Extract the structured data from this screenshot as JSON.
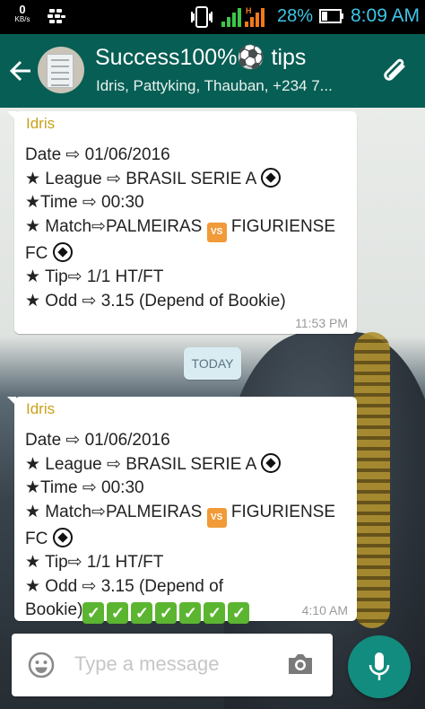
{
  "status_bar": {
    "speed_value": "0",
    "speed_unit": "KB/s",
    "network_label": "H",
    "battery_percent": "28%",
    "time": "8:09 AM"
  },
  "header": {
    "title": "Success100%⚽ tips",
    "subtitle": "Idris, Pattyking, Thauban, +234 7..."
  },
  "messages": [
    {
      "sender": "Idris",
      "lines": [
        "Date ⇨ 01/06/2016",
        "★ League ⇨ BRASIL SERIE A",
        "★Time ⇨ 00:30",
        "★ Match⇨PALMEIRAS",
        "FIGURIENSE",
        "FC",
        "★ Tip⇨ 1/1 HT/FT",
        "★ Odd ⇨ 3.15 (Depend of Bookie)"
      ],
      "time": "11:53 PM"
    },
    {
      "sender": "Idris",
      "lines": [
        "Date ⇨ 01/06/2016",
        "★ League ⇨ BRASIL SERIE A",
        "★Time ⇨ 00:30",
        "★ Match⇨PALMEIRAS",
        "FIGURIENSE",
        "FC",
        "★ Tip⇨ 1/1 HT/FT",
        "★ Odd ⇨ 3.15 (Depend of",
        "Bookie)"
      ],
      "time": "4:10 AM",
      "checkmark_count": 7
    }
  ],
  "date_divider": "TODAY",
  "composer": {
    "placeholder": "Type a message"
  },
  "colors": {
    "header": "#075e54",
    "accent": "#128c7e",
    "sender": "#c8a11a"
  }
}
